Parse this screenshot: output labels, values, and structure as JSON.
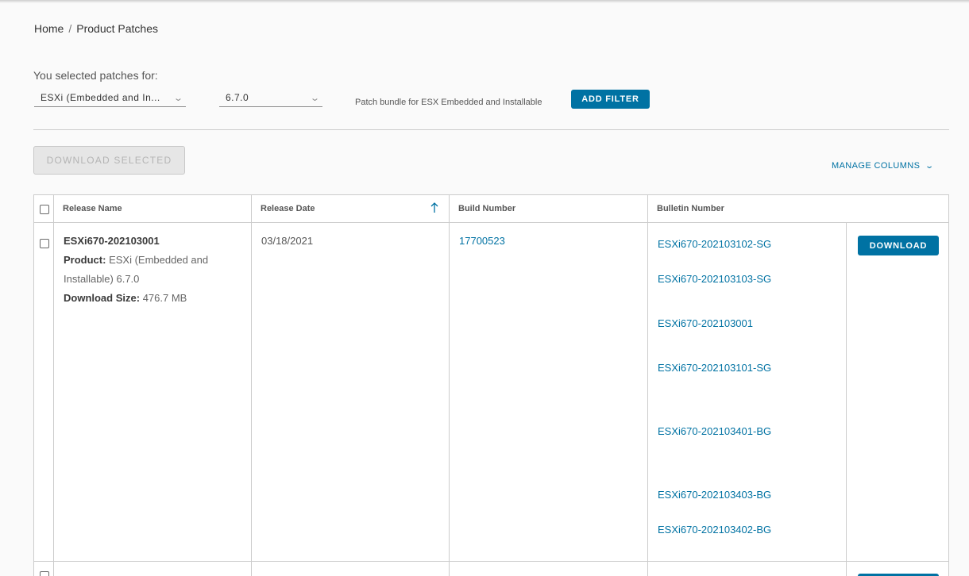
{
  "breadcrumb": {
    "home": "Home",
    "separator": "/",
    "current": "Product Patches"
  },
  "filters": {
    "label": "You selected patches for:",
    "product": {
      "value": "ESXi (Embedded and In...",
      "icon": "chevron-down-icon"
    },
    "version": {
      "value": "6.7.0",
      "icon": "chevron-down-icon"
    },
    "bundle_description": "Patch bundle for ESX Embedded and Installable",
    "add_filter_label": "ADD FILTER"
  },
  "actions": {
    "download_selected_label": "DOWNLOAD SELECTED",
    "manage_columns_label": "MANAGE COLUMNS"
  },
  "table": {
    "columns": [
      "Release Name",
      "Release Date",
      "Build Number",
      "Bulletin Number"
    ],
    "sort": {
      "column": "Release Date",
      "direction": "ascending"
    },
    "rows": [
      {
        "release_name": "ESXi670-202103001",
        "product_label": "Product:",
        "product_value_1": "ESXi (Embedded and",
        "product_value_2": "Installable) 6.7.0",
        "size_label": "Download Size:",
        "size_value": "476.7 MB",
        "release_date": "03/18/2021",
        "build_number": "17700523",
        "bulletins": [
          "ESXi670-202103102-SG",
          "ESXi670-202103103-SG",
          "ESXi670-202103001",
          "ESXi670-202103101-SG",
          "ESXi670-202103401-BG",
          "ESXi670-202103403-BG",
          "ESXi670-202103402-BG"
        ],
        "download_label": "DOWNLOAD"
      }
    ]
  },
  "colors": {
    "accent": "#0072a3",
    "border": "#cccccc",
    "background": "#fafafa"
  }
}
